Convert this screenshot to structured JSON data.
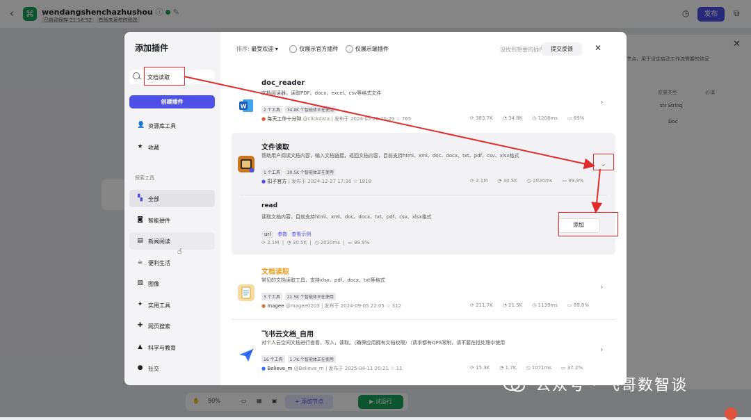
{
  "app": {
    "name": "wendangshenchazhushou",
    "autosave": "已自动保存 21:16:52",
    "unpublished": "有尚未发布的修改",
    "publish_label": "发布",
    "back_icon": "chevron-left-icon"
  },
  "right_panel": {
    "desc_text": "节点，用于设定启动工作流需要的信息",
    "col_type": "变量类型",
    "col_required": "必填",
    "row1_type": "str String",
    "row2_type": "Doc"
  },
  "bottom_toolbar": {
    "zoom": "90%",
    "add_node": "+ 添加节点",
    "run": "▶ 试运行"
  },
  "modal": {
    "title": "添加插件",
    "search_value": "文档读取",
    "create_button": "创建插件",
    "nav_top": [
      {
        "label": "资源库工具",
        "icon": "person-icon"
      },
      {
        "label": "收藏",
        "icon": "star-icon"
      }
    ],
    "section_title": "探索工具",
    "nav_explore": [
      {
        "label": "全部",
        "icon": "grid-icon"
      },
      {
        "label": "智能硬件",
        "icon": "chip-icon"
      },
      {
        "label": "新闻阅读",
        "icon": "news-icon"
      },
      {
        "label": "便利生活",
        "icon": "coffee-icon"
      },
      {
        "label": "图像",
        "icon": "image-icon"
      },
      {
        "label": "实用工具",
        "icon": "wrench-icon"
      },
      {
        "label": "网页搜索",
        "icon": "globe-search-icon"
      },
      {
        "label": "科学与教育",
        "icon": "graduation-cap-icon"
      },
      {
        "label": "社交",
        "icon": "chat-icon"
      }
    ],
    "sort_label": "排序:",
    "sort_value": "最受欢迎",
    "filter_official": "仅展示官方插件",
    "filter_cloud": "仅展示端插件",
    "no_plugin_text": "没找到想要的插件?",
    "feedback_button": "提交反馈",
    "plugins": [
      {
        "title": "doc_reader",
        "desc": "文档阅读器，读取PDF、docx、excel、csv等格式文件",
        "tags": [
          "2 个工具",
          "34.8K 个智能体正在使用"
        ],
        "author": "每天工作十分钟",
        "handle": "@clickdata",
        "published": "发布于 2024-05-20 20:29",
        "stars": "765",
        "stats": [
          "383.7K",
          "34.8K",
          "1208ms",
          "69%"
        ],
        "icon_color": "#2b5cbf"
      },
      {
        "title": "文件读取",
        "desc": "帮助用户阅读文档内容，输入文档链接，返回文档内容，目前支持html、xml、doc、docx、txt、pdf、csv、xlsx格式",
        "tags": [
          "1 个工具",
          "30.5K 个智能体正在使用"
        ],
        "author": "扣子官方",
        "handle": "",
        "published": "发布于 2024-12-27 17:30",
        "stars": "1818",
        "stats": [
          "2.1M",
          "30.5K",
          "2020ms",
          "99.9%"
        ],
        "icon_color": "#c9781f",
        "tool": {
          "name": "read",
          "desc": "读取文档内容，目前支持html、xml、doc、docx、txt、pdf、csv、xlsx格式",
          "param": "url",
          "param_label": "参数",
          "example_label": "查看示例",
          "stats": [
            "2.1M",
            "30.5K",
            "2020ms",
            "99.9%"
          ],
          "add_label": "添加"
        }
      },
      {
        "title": "文档读取",
        "desc": "常见的文档读取工具，支持xlsx、pdf、docx、txt等格式",
        "tags": [
          "3 个工具",
          "21.5K 个智能体正在使用"
        ],
        "author": "magee",
        "handle": "@magee0203",
        "published": "发布于 2024-09-05 22:05",
        "stars": "312",
        "stats": [
          "211.7K",
          "21.5K",
          "1139ms",
          "89.8%"
        ],
        "icon_color": "#f3b23a"
      },
      {
        "title": "飞书云文档_自用",
        "desc": "对个人云空间文档进行查看，写入，读取。（确保应用拥有文档权限）（请求都有QPS限制，请不要在批处理中使用",
        "tags": [
          "16 个工具",
          "1.7K 个智能体正在使用"
        ],
        "author": "Believe_m",
        "handle": "@Believe_m",
        "published": "发布于 2025-04-11 20:21",
        "stars": "11",
        "stats": [
          "15.3K",
          "1.7K",
          "1071ms",
          "37.2%"
        ],
        "icon_color": "#3370ff"
      }
    ]
  },
  "watermark": "公众号 · 飞哥数智谈",
  "annotation_color": "#e02b2b"
}
